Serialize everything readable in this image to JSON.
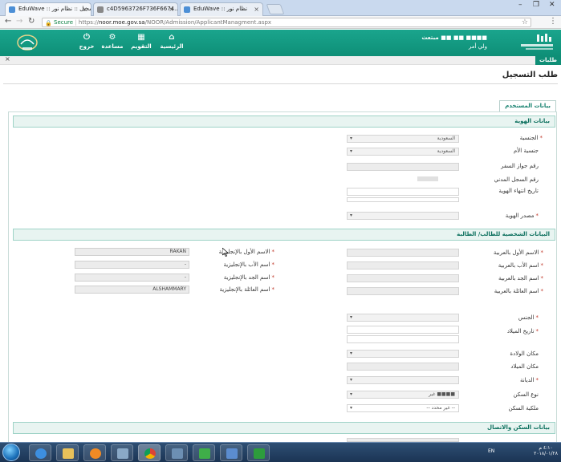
{
  "browser": {
    "tabs": [
      {
        "title": "EduWave :: تسجيل :: نظام نور"
      },
      {
        "title": "c4D5963726F736F6674..."
      },
      {
        "title": "EduWave :: نظام نور"
      },
      {
        "title": "EduWave :: تسجيل :: نظام نور"
      }
    ],
    "secure_label": "Secure",
    "url_scheme": "https://",
    "url_host": "noor.moe.gov.sa",
    "url_path": "/NOOR/Admission/ApplicantManagment.aspx"
  },
  "header": {
    "nav": [
      {
        "label": "خروج",
        "icon": "power-icon"
      },
      {
        "label": "مساعدة",
        "icon": "gear-icon"
      },
      {
        "label": "التقويم",
        "icon": "calendar-icon"
      },
      {
        "label": "الرئيسية",
        "icon": "home-icon"
      }
    ],
    "user_name": "مبتعث ■■ ■■ ■■■■",
    "user_role": "ولي أمر"
  },
  "tabrow": {
    "close": "×",
    "chip": "طلبات"
  },
  "page_title": "طلب التسجيل",
  "panel_tab": "بيانات المستخدم",
  "sections": {
    "identity": "بيانات الهوية",
    "personal": "البيانات الشخصية للطالب/ الطالبة",
    "contact": "بيانات السكن والاتصال"
  },
  "identity_fields": [
    {
      "label": "الجنسية",
      "value": "السعودية",
      "type": "select",
      "required": true
    },
    {
      "label": "جنسية الأم",
      "value": "السعودية",
      "type": "select",
      "required": false
    },
    {
      "label": "رقم جواز السفر",
      "value": "",
      "type": "text",
      "required": false
    },
    {
      "label": "رقم السجل المدني",
      "value": "",
      "type": "text",
      "required": false
    },
    {
      "label": "تاريخ انتهاء الهوية",
      "value": "",
      "type": "text",
      "required": false
    },
    {
      "label": "مصدر الهوية",
      "value": "",
      "type": "text",
      "required": true
    }
  ],
  "personal_arabic": [
    {
      "label": "الاسم الأول بالعربية",
      "required": true
    },
    {
      "label": "اسم الأب بالعربية",
      "required": true
    },
    {
      "label": "اسم الجد بالعربية",
      "required": true
    },
    {
      "label": "اسم العائلة بالعربية",
      "required": true
    }
  ],
  "personal_english": [
    {
      "label": "الاسم الأول بالإنجليزية",
      "value": "RAKAN",
      "required": true
    },
    {
      "label": "اسم الأب بالإنجليزية",
      "value": "-",
      "required": true
    },
    {
      "label": "اسم الجد بالإنجليزية",
      "value": "-",
      "required": true
    },
    {
      "label": "اسم العائلة بالإنجليزية",
      "value": "ALSHAMMARY",
      "required": true
    }
  ],
  "other_fields": [
    {
      "label": "الجنس",
      "required": true
    },
    {
      "label": "تاريخ الميلاد",
      "required": true
    },
    {
      "label": "مكان الولادة",
      "required": false
    },
    {
      "label": "مكان الميلاد",
      "required": false
    },
    {
      "label": "الديانة",
      "required": true
    },
    {
      "label": "نوع السكن",
      "value": "غير ■■■■",
      "required": false
    },
    {
      "label": "ملكية السكن",
      "value": "-- غير محدد --",
      "required": false
    }
  ],
  "taskbar": {
    "lang": "EN",
    "time": "٤:١٠ م",
    "date": "٢٠١٨/٠١/٢٨"
  }
}
